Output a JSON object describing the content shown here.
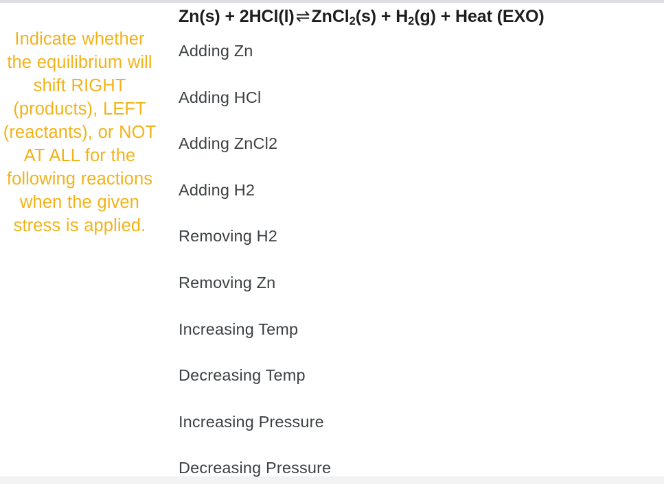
{
  "page": {
    "background_color": "#ffffff",
    "top_band_color": "#dcdee1",
    "bottom_band_color": "#f1f3f4"
  },
  "prompt": {
    "text": "Indicate whether the equilibrium will shift RIGHT (products), LEFT (reactants), or NOT AT ALL for the following reactions when the given stress is applied.",
    "color": "#f2b319"
  },
  "question": {
    "equation": {
      "full_text": "Zn(s) + 2HCl(l) ⇌ ZnCl2(s) + H2(g) + Heat (EXO)",
      "reactants": "Zn(s) + 2HCl(l)",
      "arrow": "⇌",
      "product_1_prefix": "ZnCl",
      "product_1_sub": "2",
      "product_1_suffix": "(s) + H",
      "product_2_sub": "2",
      "product_2_suffix": "(g) + Heat (EXO)",
      "color": "#1d1d1d"
    },
    "items_color": "#3c4043",
    "items": [
      {
        "label": "Adding Zn"
      },
      {
        "label": "Adding HCl"
      },
      {
        "label": "Adding ZnCl2"
      },
      {
        "label": "Adding H2"
      },
      {
        "label": "Removing H2"
      },
      {
        "label": "Removing Zn"
      },
      {
        "label": "Increasing Temp"
      },
      {
        "label": "Decreasing Temp"
      },
      {
        "label": "Increasing Pressure"
      },
      {
        "label": "Decreasing Pressure"
      }
    ]
  }
}
